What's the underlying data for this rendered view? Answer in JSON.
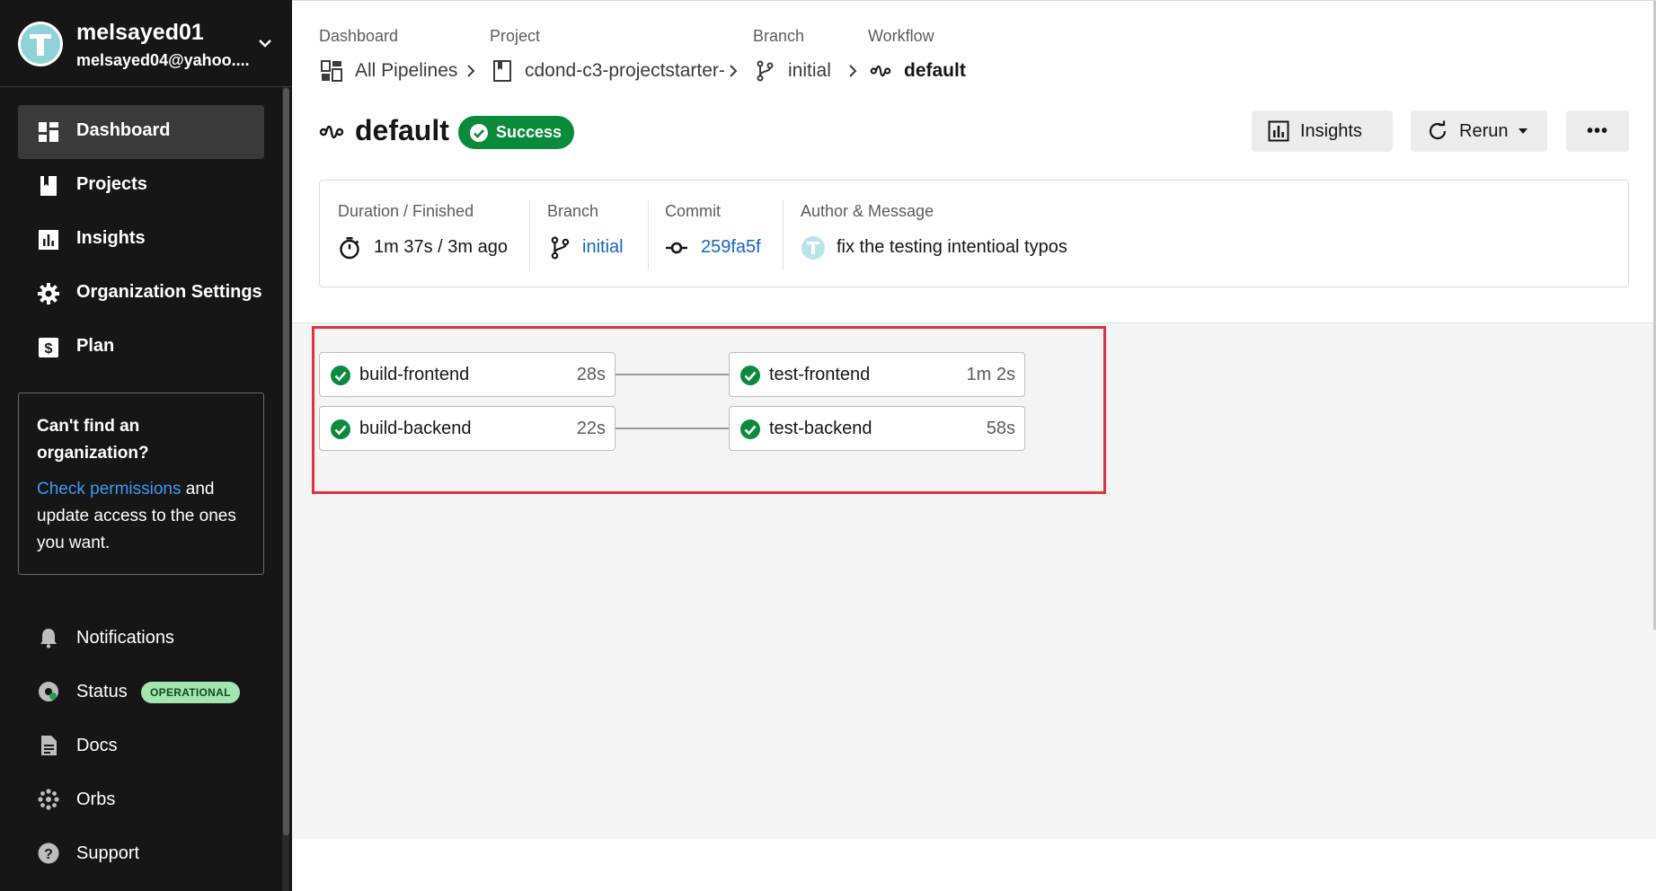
{
  "user": {
    "name": "melsayed01",
    "email": "melsayed04@yahoo...."
  },
  "nav": [
    {
      "label": "Dashboard",
      "icon": "dashboard-icon",
      "active": true
    },
    {
      "label": "Projects",
      "icon": "projects-icon"
    },
    {
      "label": "Insights",
      "icon": "insights-icon"
    },
    {
      "label": "Organization Settings",
      "icon": "gear-icon"
    },
    {
      "label": "Plan",
      "icon": "dollar-icon"
    }
  ],
  "org_box": {
    "title": "Can't find an organization?",
    "link": "Check permissions",
    "text": " and update access to the ones you want."
  },
  "bottom_nav": [
    {
      "label": "Notifications",
      "icon": "bell-icon"
    },
    {
      "label": "Status",
      "icon": "status-gauge-icon",
      "badge": "OPERATIONAL"
    },
    {
      "label": "Docs",
      "icon": "doc-icon"
    },
    {
      "label": "Orbs",
      "icon": "orbs-icon"
    },
    {
      "label": "Support",
      "icon": "help-icon"
    }
  ],
  "breadcrumbs": {
    "dashboard_label": "Dashboard",
    "dashboard_value": "All Pipelines",
    "project_label": "Project",
    "project_value": "cdond-c3-projectstarter-",
    "branch_label": "Branch",
    "branch_value": "initial",
    "workflow_label": "Workflow",
    "workflow_value": "default"
  },
  "workflow": {
    "title": "default",
    "status": "Success"
  },
  "actions": {
    "insights": "Insights",
    "rerun": "Rerun",
    "more": "•••"
  },
  "summary": {
    "duration_label": "Duration / Finished",
    "duration_value": "1m 37s / 3m ago",
    "branch_label": "Branch",
    "branch_value": "initial",
    "commit_label": "Commit",
    "commit_value": "259fa5f",
    "author_label": "Author & Message",
    "message": "fix the testing intentioal typos"
  },
  "jobs": [
    {
      "name": "build-frontend",
      "duration": "28s",
      "status": "success"
    },
    {
      "name": "build-backend",
      "duration": "22s",
      "status": "success"
    },
    {
      "name": "test-frontend",
      "duration": "1m 2s",
      "status": "success"
    },
    {
      "name": "test-backend",
      "duration": "58s",
      "status": "success"
    }
  ],
  "colors": {
    "success": "#0a8a3b",
    "link": "#1566c2",
    "sidebar": "#161616",
    "highlight": "#e0323c",
    "status_badge": "#a2e5b0"
  }
}
